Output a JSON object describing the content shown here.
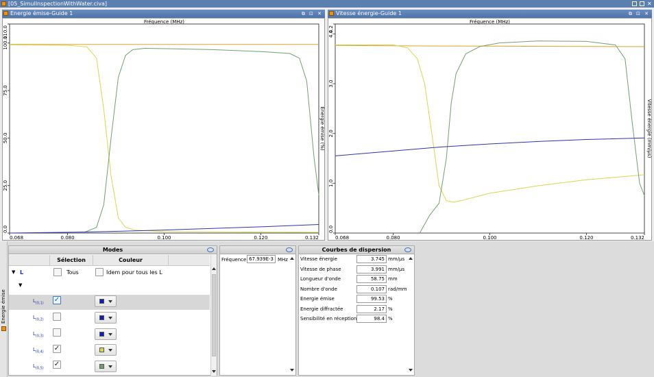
{
  "window": {
    "title": "[05_SimulInspectionWithWater.civa]"
  },
  "left_panel": {
    "title": "Energie émise-Guide 1",
    "buttons": "⧉ ⊡ ✕",
    "x_title": "Fréquence (MHz)",
    "y_title": "Energie émise (%)"
  },
  "right_panel": {
    "title": "Vitesse énergie-Guide 1",
    "buttons": "⧉ ⊡ ✕",
    "x_title": "Fréquence (MHz)",
    "y_title": "Vitesse énergie (mm/µs)"
  },
  "chart_data": [
    {
      "type": "line",
      "xlabel": "Fréquence (MHz)",
      "ylabel": "Energie émise (%)",
      "xlim": [
        0.068,
        0.132
      ],
      "ylim": [
        0.0,
        110.0
      ],
      "x_ticks": [
        "0.068",
        "0.080",
        "0.100",
        "0.120",
        "0.132"
      ],
      "y_ticks": [
        "0.0",
        "25.0",
        "50.0",
        "75.0",
        "100.0",
        "110.0"
      ],
      "series": [
        {
          "color": "#e0a030",
          "x": [
            0.068,
            0.132
          ],
          "y": [
            99.3,
            99.3
          ]
        },
        {
          "color": "#d8d850",
          "x": [
            0.068,
            0.08,
            0.084,
            0.086,
            0.0875,
            0.089,
            0.0905,
            0.092,
            0.094,
            0.1,
            0.12,
            0.132
          ],
          "y": [
            99.0,
            98.8,
            98.0,
            92.0,
            65.0,
            30.0,
            8.0,
            3.0,
            1.5,
            0.8,
            0.5,
            0.4
          ]
        },
        {
          "color": "#70a070",
          "x": [
            0.0835,
            0.086,
            0.0875,
            0.089,
            0.0905,
            0.092,
            0.0935,
            0.096,
            0.1,
            0.11,
            0.12,
            0.126,
            0.128,
            0.1295,
            0.131,
            0.132
          ],
          "y": [
            0.4,
            3.0,
            15.0,
            50.0,
            82.0,
            93.5,
            96.5,
            97.2,
            97.0,
            96.5,
            95.5,
            94.5,
            92.0,
            80.0,
            40.0,
            20.0
          ]
        },
        {
          "color": "#3030b0",
          "x": [
            0.068,
            0.08,
            0.09,
            0.1,
            0.11,
            0.12,
            0.132
          ],
          "y": [
            0.0,
            0.4,
            0.9,
            1.6,
            2.4,
            3.3,
            4.5
          ]
        }
      ]
    },
    {
      "type": "line",
      "xlabel": "Fréquence (MHz)",
      "ylabel": "Vitesse énergie (mm/µs)",
      "xlim": [
        0.068,
        0.132
      ],
      "ylim": [
        0.0,
        4.2
      ],
      "x_ticks": [
        "0.068",
        "0.080",
        "0.100",
        "0.120",
        "0.132"
      ],
      "y_ticks": [
        "0.0",
        "1.0",
        "2.0",
        "3.0",
        "4.0",
        "4.2"
      ],
      "series": [
        {
          "color": "#e0a030",
          "x": [
            0.068,
            0.085,
            0.1,
            0.12,
            0.132
          ],
          "y": [
            3.77,
            3.76,
            3.755,
            3.748,
            3.745
          ]
        },
        {
          "color": "#d8d850",
          "x": [
            0.068,
            0.08,
            0.083,
            0.085,
            0.0865,
            0.088,
            0.0895,
            0.091,
            0.0925,
            0.094,
            0.1,
            0.11,
            0.12,
            0.132
          ],
          "y": [
            3.78,
            3.78,
            3.72,
            3.5,
            3.0,
            2.0,
            0.95,
            0.65,
            0.62,
            0.65,
            0.8,
            0.95,
            1.07,
            1.17
          ]
        },
        {
          "color": "#70a070",
          "x": [
            0.0855,
            0.0875,
            0.0895,
            0.091,
            0.092,
            0.093,
            0.095,
            0.098,
            0.102,
            0.11,
            0.12,
            0.126,
            0.128,
            0.1295,
            0.131,
            0.132
          ],
          "y": [
            0.0,
            0.35,
            0.6,
            1.5,
            2.6,
            3.2,
            3.6,
            3.75,
            3.82,
            3.86,
            3.85,
            3.78,
            3.5,
            2.2,
            1.0,
            0.75
          ]
        },
        {
          "color": "#3030b0",
          "x": [
            0.068,
            0.08,
            0.09,
            0.1,
            0.11,
            0.12,
            0.132
          ],
          "y": [
            1.55,
            1.65,
            1.73,
            1.79,
            1.84,
            1.88,
            1.91
          ]
        }
      ]
    }
  ],
  "sidebar_tab": {
    "label": "Energie émise"
  },
  "modes": {
    "title": "Modes",
    "col_selection": "Sélection",
    "col_couleur": "Couleur",
    "group_label": "L",
    "tous_label": "Tous",
    "idem_label": "Idem pour tous les L",
    "rows": [
      {
        "name": "L",
        "sub": "(0,1)",
        "checked": "✓",
        "swatch": "#1020b0"
      },
      {
        "name": "L",
        "sub": "(0,2)",
        "checked": "",
        "swatch": "#1020b0"
      },
      {
        "name": "L",
        "sub": "(0,3)",
        "checked": "",
        "swatch": "#1020b0"
      },
      {
        "name": "L",
        "sub": "(0,4)",
        "checked": "✓",
        "swatch": "#d8d850"
      },
      {
        "name": "L",
        "sub": "(0,5)",
        "checked": "✓",
        "swatch": "#70a070"
      }
    ]
  },
  "frequency": {
    "label": "Fréquence",
    "value": "67.939E-3",
    "unit": "MHz"
  },
  "dispersion": {
    "title": "Courbes de dispersion",
    "rows": [
      {
        "label": "Vitesse énergie",
        "value": "3.745",
        "unit": "mm/µs"
      },
      {
        "label": "Vitesse de phase",
        "value": "3.991",
        "unit": "mm/µs"
      },
      {
        "label": "Longueur d'onde",
        "value": "58.75",
        "unit": "mm"
      },
      {
        "label": "Nombre d'onde",
        "value": "0.107",
        "unit": "rad/mm"
      },
      {
        "label": "Energie émise",
        "value": "99.53",
        "unit": "%"
      },
      {
        "label": "Energie diffractée",
        "value": "2.17",
        "unit": "%"
      },
      {
        "label": "Sensibilité en réception",
        "value": "98.4",
        "unit": "%"
      }
    ]
  }
}
